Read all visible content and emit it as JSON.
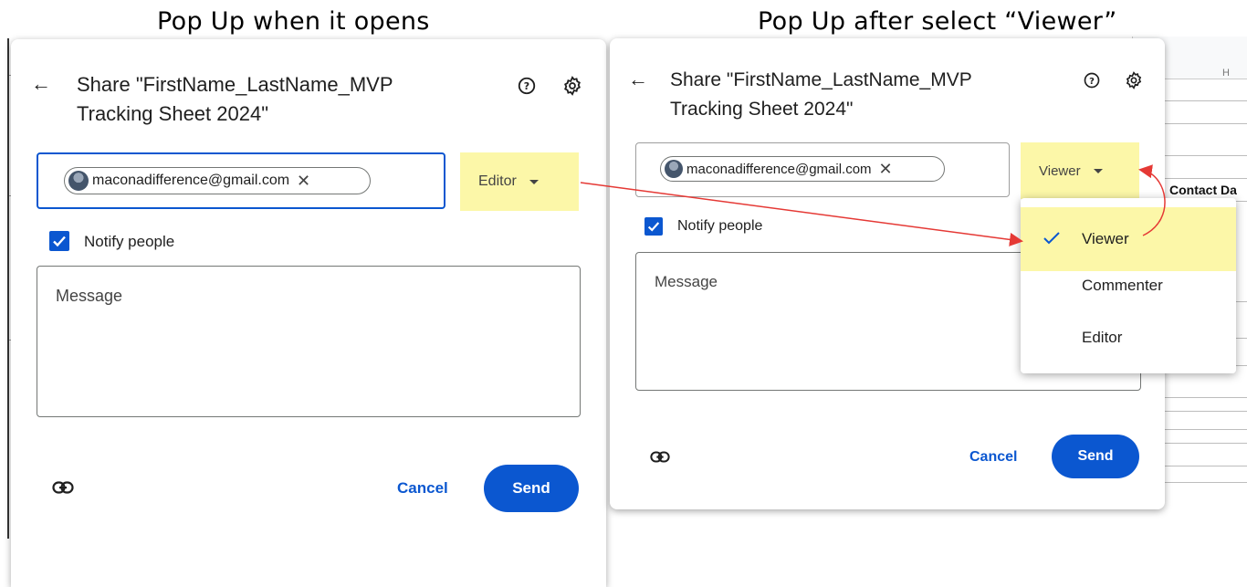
{
  "captions": {
    "left": "Pop Up when it opens",
    "right": "Pop Up after select “Viewer”"
  },
  "sheet": {
    "column_header": "H",
    "column_title": "Contact Da"
  },
  "left_dialog": {
    "title_line1": "Share \"FirstName_LastName_MVP",
    "title_line2": "Tracking Sheet 2024\"",
    "chip_email": "maconadifference@gmail.com",
    "role": "Editor",
    "notify_label": "Notify people",
    "message_placeholder": "Message",
    "cancel_label": "Cancel",
    "send_label": "Send"
  },
  "right_dialog": {
    "title_line1": "Share \"FirstName_LastName_MVP",
    "title_line2": "Tracking Sheet 2024\"",
    "chip_email": "maconadifference@gmail.com",
    "role": "Viewer",
    "notify_label": "Notify people",
    "message_placeholder": "Message",
    "cancel_label": "Cancel",
    "send_label": "Send"
  },
  "role_menu": {
    "items": [
      "Viewer",
      "Commenter",
      "Editor"
    ],
    "selected": "Viewer"
  },
  "icons": {
    "back": "arrow-back-icon",
    "help": "help-circle-icon",
    "settings": "gear-icon",
    "link": "link-icon",
    "close": "close-icon",
    "dropdown": "caret-down-icon",
    "check": "check-icon"
  },
  "colors": {
    "primary_blue": "#0b57d0",
    "highlight_yellow": "#fcf7a8",
    "annotation_red": "#e53935"
  }
}
